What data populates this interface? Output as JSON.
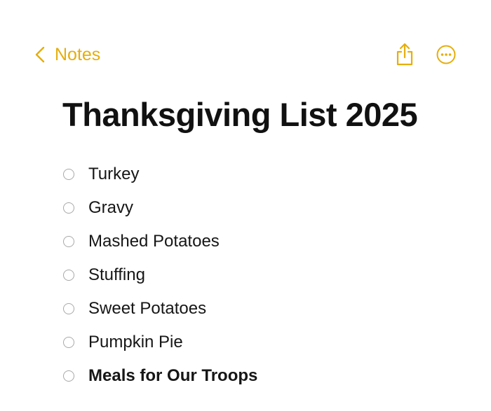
{
  "nav": {
    "back_label": "Notes",
    "accent_color": "#E5AE0C",
    "back_icon": "chevron-left-icon",
    "share_icon": "share-icon",
    "more_icon": "ellipsis-circle-icon"
  },
  "note": {
    "title": "Thanksgiving List 2025",
    "items": [
      {
        "text": "Turkey",
        "checked": false,
        "bold": false
      },
      {
        "text": "Gravy",
        "checked": false,
        "bold": false
      },
      {
        "text": "Mashed Potatoes",
        "checked": false,
        "bold": false
      },
      {
        "text": "Stuffing",
        "checked": false,
        "bold": false
      },
      {
        "text": "Sweet Potatoes",
        "checked": false,
        "bold": false
      },
      {
        "text": "Pumpkin Pie",
        "checked": false,
        "bold": false
      },
      {
        "text": "Meals for Our Troops",
        "checked": false,
        "bold": true
      }
    ]
  }
}
